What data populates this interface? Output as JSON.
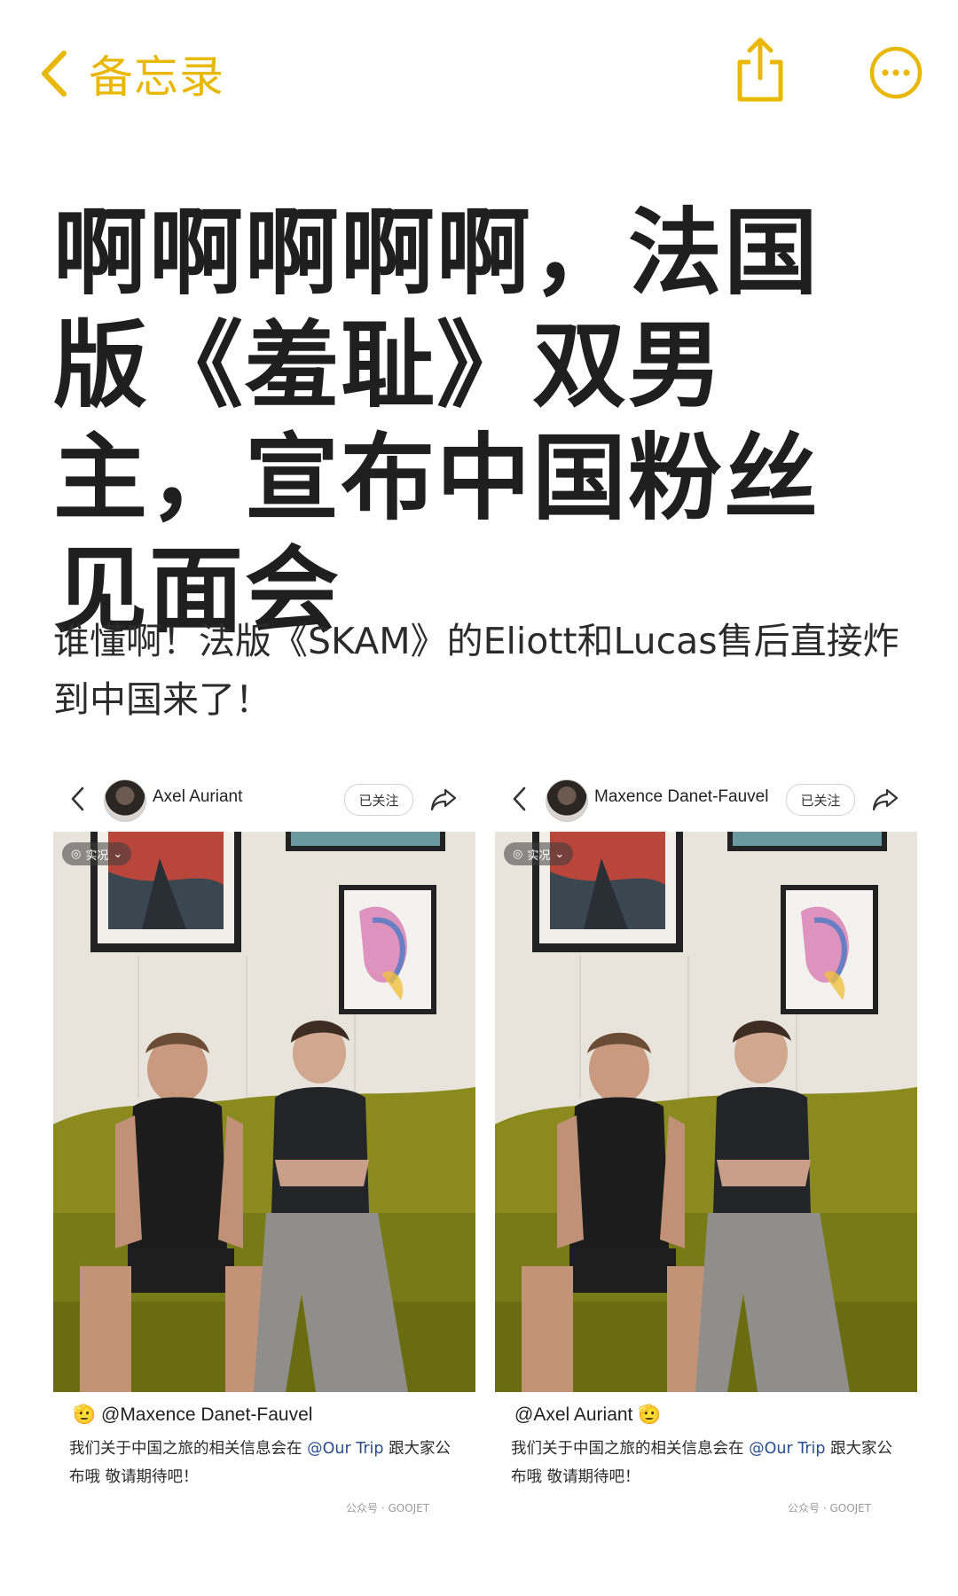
{
  "nav": {
    "back_label": "备忘录",
    "accent_color": "#E9B806"
  },
  "headline": "啊啊啊啊啊，法国版《羞耻》双男主，宣布中国粉丝见面会",
  "subtitle": "谁懂啊！法版《SKAM》的Eliott和Lucas售后直接炸到中国来了！",
  "posts": [
    {
      "author": "Axel Auriant",
      "follow_label": "已关注",
      "live_label": "实况",
      "mention": "@Maxence Danet-Fauvel",
      "mention_emoji": "🫡",
      "caption_pre": "我们关于中国之旅的相关信息会在",
      "caption_link": "@Our Trip",
      "caption_post": " 跟大家公布哦 敬请期待吧！",
      "watermark": "公众号 · GOOJET"
    },
    {
      "author": "Maxence Danet-Fauvel",
      "follow_label": "已关注",
      "live_label": "实况",
      "mention": "@Axel Auriant",
      "mention_emoji": "🫡",
      "caption_pre": "我们关于中国之旅的相关信息会在",
      "caption_link": "@Our Trip",
      "caption_post": " 跟大家公布哦 敬请期待吧！",
      "watermark": "公众号 · GOOJET"
    }
  ]
}
